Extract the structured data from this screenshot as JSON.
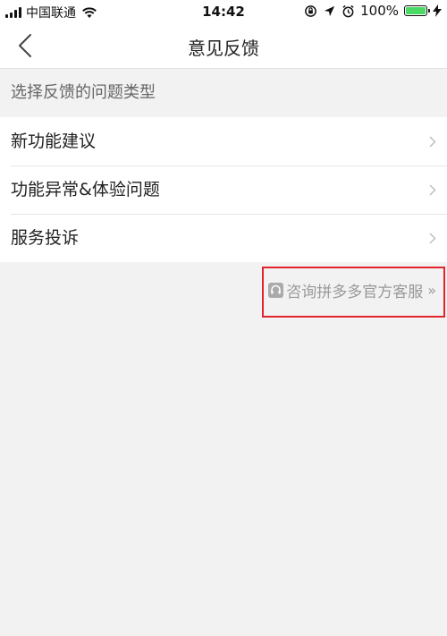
{
  "status_bar": {
    "carrier": "中国联通",
    "time": "14:42",
    "battery_percent": "100%"
  },
  "nav": {
    "title": "意见反馈"
  },
  "section": {
    "header": "选择反馈的问题类型"
  },
  "list": {
    "items": [
      {
        "label": "新功能建议"
      },
      {
        "label": "功能异常&体验问题"
      },
      {
        "label": "服务投诉"
      }
    ]
  },
  "service": {
    "label": "咨询拼多多官方客服",
    "arrow": "»"
  },
  "colors": {
    "highlight": "#e3242b",
    "battery": "#4cd964"
  }
}
